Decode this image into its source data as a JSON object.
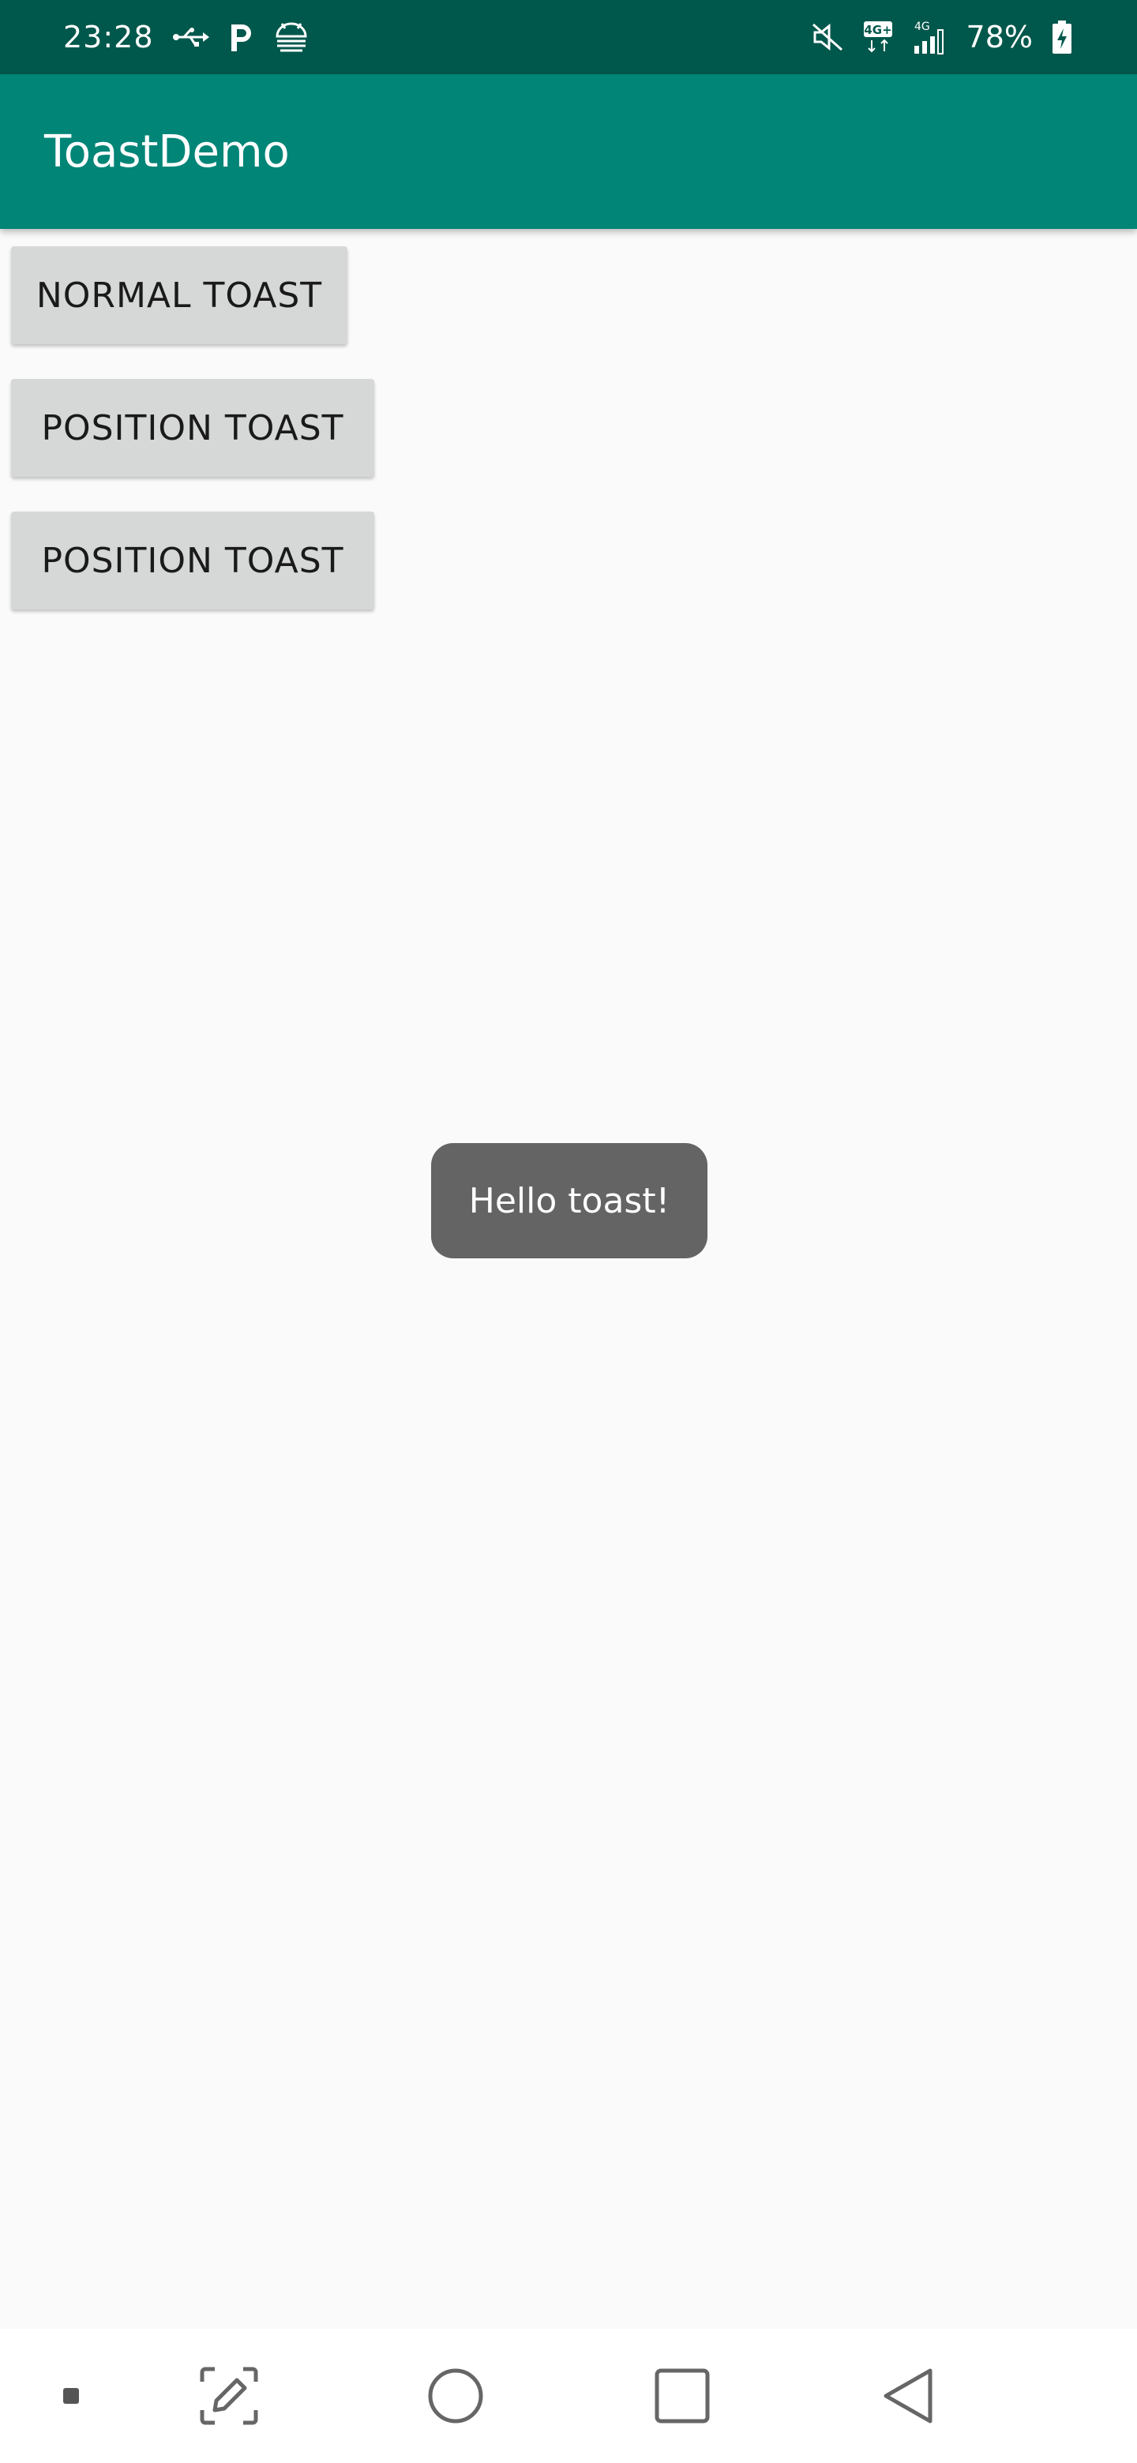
{
  "status_bar": {
    "time": "23:28",
    "battery_percent": "78%",
    "net_badge_1": "4G+",
    "net_badge_2": "4G",
    "icons": [
      "usb-icon",
      "parking-icon",
      "android-debug-icon",
      "mute-icon",
      "network-4g-plus-icon",
      "signal-icon",
      "battery-icon"
    ]
  },
  "app_bar": {
    "title": "ToastDemo"
  },
  "buttons": {
    "normal": "NORMAL TOAST",
    "position_1": "POSITION TOAST",
    "position_2": "POSITION TOAST"
  },
  "toast": {
    "message": "Hello toast!"
  },
  "nav_bar": {
    "icons": [
      "dot-icon",
      "edit-screenshot-icon",
      "home-icon",
      "recents-icon",
      "back-icon"
    ]
  },
  "colors": {
    "status_bar": "#00574b",
    "app_bar": "#008577",
    "background": "#fafafa",
    "button": "#d6d7d7",
    "toast": "#646464"
  }
}
